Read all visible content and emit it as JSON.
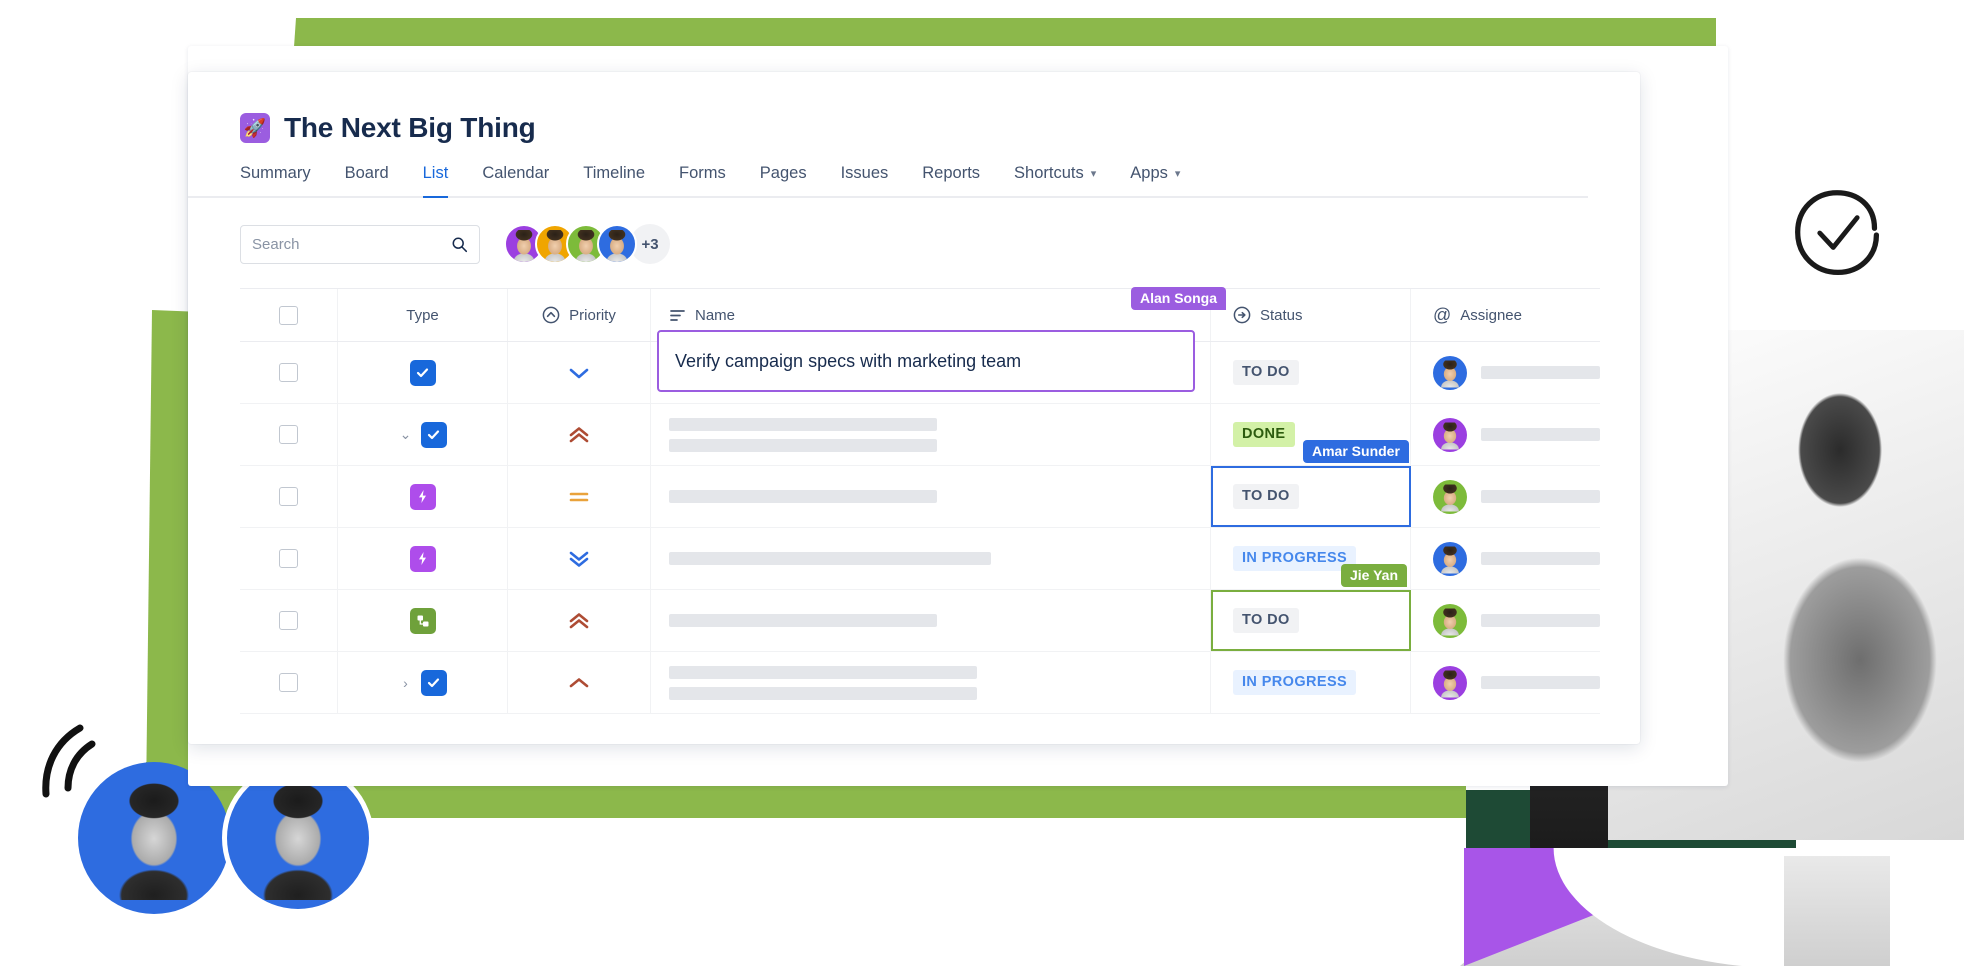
{
  "project": {
    "title": "The Next Big Thing",
    "icon": "rocket-icon",
    "icon_glyph": "🚀",
    "icon_bg": "#9B5DE0"
  },
  "tabs": [
    {
      "label": "Summary",
      "active": false,
      "caret": false
    },
    {
      "label": "Board",
      "active": false,
      "caret": false
    },
    {
      "label": "List",
      "active": true,
      "caret": false
    },
    {
      "label": "Calendar",
      "active": false,
      "caret": false
    },
    {
      "label": "Timeline",
      "active": false,
      "caret": false
    },
    {
      "label": "Forms",
      "active": false,
      "caret": false
    },
    {
      "label": "Pages",
      "active": false,
      "caret": false
    },
    {
      "label": "Issues",
      "active": false,
      "caret": false
    },
    {
      "label": "Reports",
      "active": false,
      "caret": false
    },
    {
      "label": "Shortcuts",
      "active": false,
      "caret": true
    },
    {
      "label": "Apps",
      "active": false,
      "caret": true
    }
  ],
  "search": {
    "placeholder": "Search",
    "value": "",
    "icon": "search-icon"
  },
  "members": {
    "avatars": [
      {
        "ring": "#9B3FE0"
      },
      {
        "ring": "#F0A500"
      },
      {
        "ring": "#7DBB3A"
      },
      {
        "ring": "#2E6CE0"
      }
    ],
    "overflow_label": "+3"
  },
  "table": {
    "columns": [
      {
        "key": "select",
        "label": "",
        "icon": "checkbox-icon"
      },
      {
        "key": "type",
        "label": "Type",
        "icon": ""
      },
      {
        "key": "priority",
        "label": "Priority",
        "icon": "priority-icon"
      },
      {
        "key": "name",
        "label": "Name",
        "icon": "text-lines-icon"
      },
      {
        "key": "status",
        "label": "Status",
        "icon": "status-arrow-icon"
      },
      {
        "key": "assignee",
        "label": "Assignee",
        "icon": "at-icon"
      }
    ],
    "rows": [
      {
        "type": "task",
        "type_color": "#1868DB",
        "expander": "",
        "priority": "low",
        "priority_color": "#2E6CE0",
        "name": "Verify campaign specs with marketing team",
        "name_editing": true,
        "bars": [],
        "status": "TO DO",
        "status_style": "todo",
        "status_selected": "",
        "assignee_ring": "#2E6CE0"
      },
      {
        "type": "task",
        "type_color": "#1868DB",
        "expander": "⌄",
        "priority": "highest",
        "priority_color": "#AE4C34",
        "name": "",
        "name_editing": false,
        "bars": [
          268,
          268
        ],
        "status": "DONE",
        "status_style": "done",
        "status_selected": "",
        "assignee_ring": "#9B3FE0"
      },
      {
        "type": "story",
        "type_color": "#AE4DEB",
        "expander": "",
        "priority": "medium",
        "priority_color": "#E9A23B",
        "name": "",
        "name_editing": false,
        "bars": [
          268
        ],
        "status": "TO DO",
        "status_style": "todo",
        "status_selected": "blue",
        "assignee_ring": "#7DBB3A"
      },
      {
        "type": "story",
        "type_color": "#AE4DEB",
        "expander": "",
        "priority": "lowest",
        "priority_color": "#2E6CE0",
        "name": "",
        "name_editing": false,
        "bars": [
          322
        ],
        "status": "IN PROGRESS",
        "status_style": "progress",
        "status_selected": "",
        "assignee_ring": "#2E6CE0"
      },
      {
        "type": "subtask",
        "type_color": "#6FA13B",
        "expander": "",
        "priority": "highest",
        "priority_color": "#AE4C34",
        "name": "",
        "name_editing": false,
        "bars": [
          268
        ],
        "status": "TO DO",
        "status_style": "todo",
        "status_selected": "green",
        "assignee_ring": "#7DBB3A"
      },
      {
        "type": "task",
        "type_color": "#1868DB",
        "expander": "›",
        "priority": "high",
        "priority_color": "#AE4C34",
        "name": "",
        "name_editing": false,
        "bars": [
          308,
          308
        ],
        "status": "IN PROGRESS",
        "status_style": "progress",
        "status_selected": "",
        "assignee_ring": "#9B3FE0"
      }
    ]
  },
  "cursors": [
    {
      "name": "Alan Songa",
      "color": "#9B5DE0"
    },
    {
      "name": "Amar Sunder",
      "color": "#2E6CE0"
    },
    {
      "name": "Jie Yan",
      "color": "#7AAE3F"
    }
  ],
  "decor": {
    "green": "#8CB84B",
    "dark_green": "#1E4A35",
    "purple": "#A855E8",
    "blue": "#2E6CE0",
    "check_icon": "check-circle-icon",
    "motion_icon": "motion-arcs-icon"
  }
}
